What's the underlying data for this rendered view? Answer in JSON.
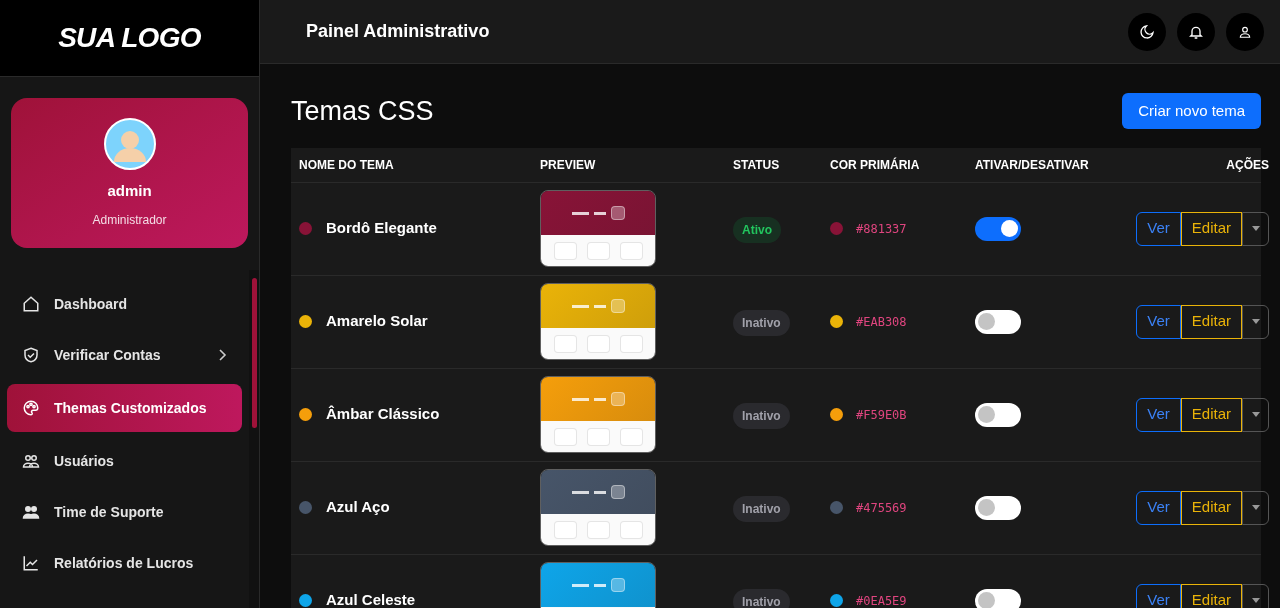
{
  "sidebar": {
    "logo": "SUA LOGO",
    "profile": {
      "name": "admin",
      "role": "Administrador"
    },
    "items": [
      {
        "label": "Dashboard",
        "selected": false,
        "has_submenu": false
      },
      {
        "label": "Verificar Contas",
        "selected": false,
        "has_submenu": true
      },
      {
        "label": "Themas Customizados",
        "selected": true,
        "has_submenu": false
      },
      {
        "label": "Usuários",
        "selected": false,
        "has_submenu": false
      },
      {
        "label": "Time de Suporte",
        "selected": false,
        "has_submenu": false
      },
      {
        "label": "Relatórios de Lucros",
        "selected": false,
        "has_submenu": false
      }
    ]
  },
  "header": {
    "title": "Painel Administrativo"
  },
  "page": {
    "title": "Temas CSS",
    "create_button": "Criar novo tema"
  },
  "table": {
    "columns": [
      "NOME DO TEMA",
      "PREVIEW",
      "STATUS",
      "COR PRIMÁRIA",
      "ATIVAR/DESATIVAR",
      "AÇÕES"
    ],
    "rows": [
      {
        "name": "Bordô Elegante",
        "color": "#881337",
        "status": "Ativo",
        "active": true,
        "hex": "#881337",
        "on": true,
        "view": "Ver",
        "edit": "Editar"
      },
      {
        "name": "Amarelo Solar",
        "color": "#eab308",
        "status": "Inativo",
        "active": false,
        "hex": "#EAB308",
        "on": false,
        "view": "Ver",
        "edit": "Editar"
      },
      {
        "name": "Âmbar Clássico",
        "color": "#f59e0b",
        "status": "Inativo",
        "active": false,
        "hex": "#F59E0B",
        "on": false,
        "view": "Ver",
        "edit": "Editar"
      },
      {
        "name": "Azul Aço",
        "color": "#475569",
        "status": "Inativo",
        "active": false,
        "hex": "#475569",
        "on": false,
        "view": "Ver",
        "edit": "Editar"
      },
      {
        "name": "Azul Celeste",
        "color": "#0ea5e9",
        "status": "Inativo",
        "active": false,
        "hex": "#0EA5E9",
        "on": false,
        "view": "Ver",
        "edit": "Editar"
      }
    ]
  }
}
